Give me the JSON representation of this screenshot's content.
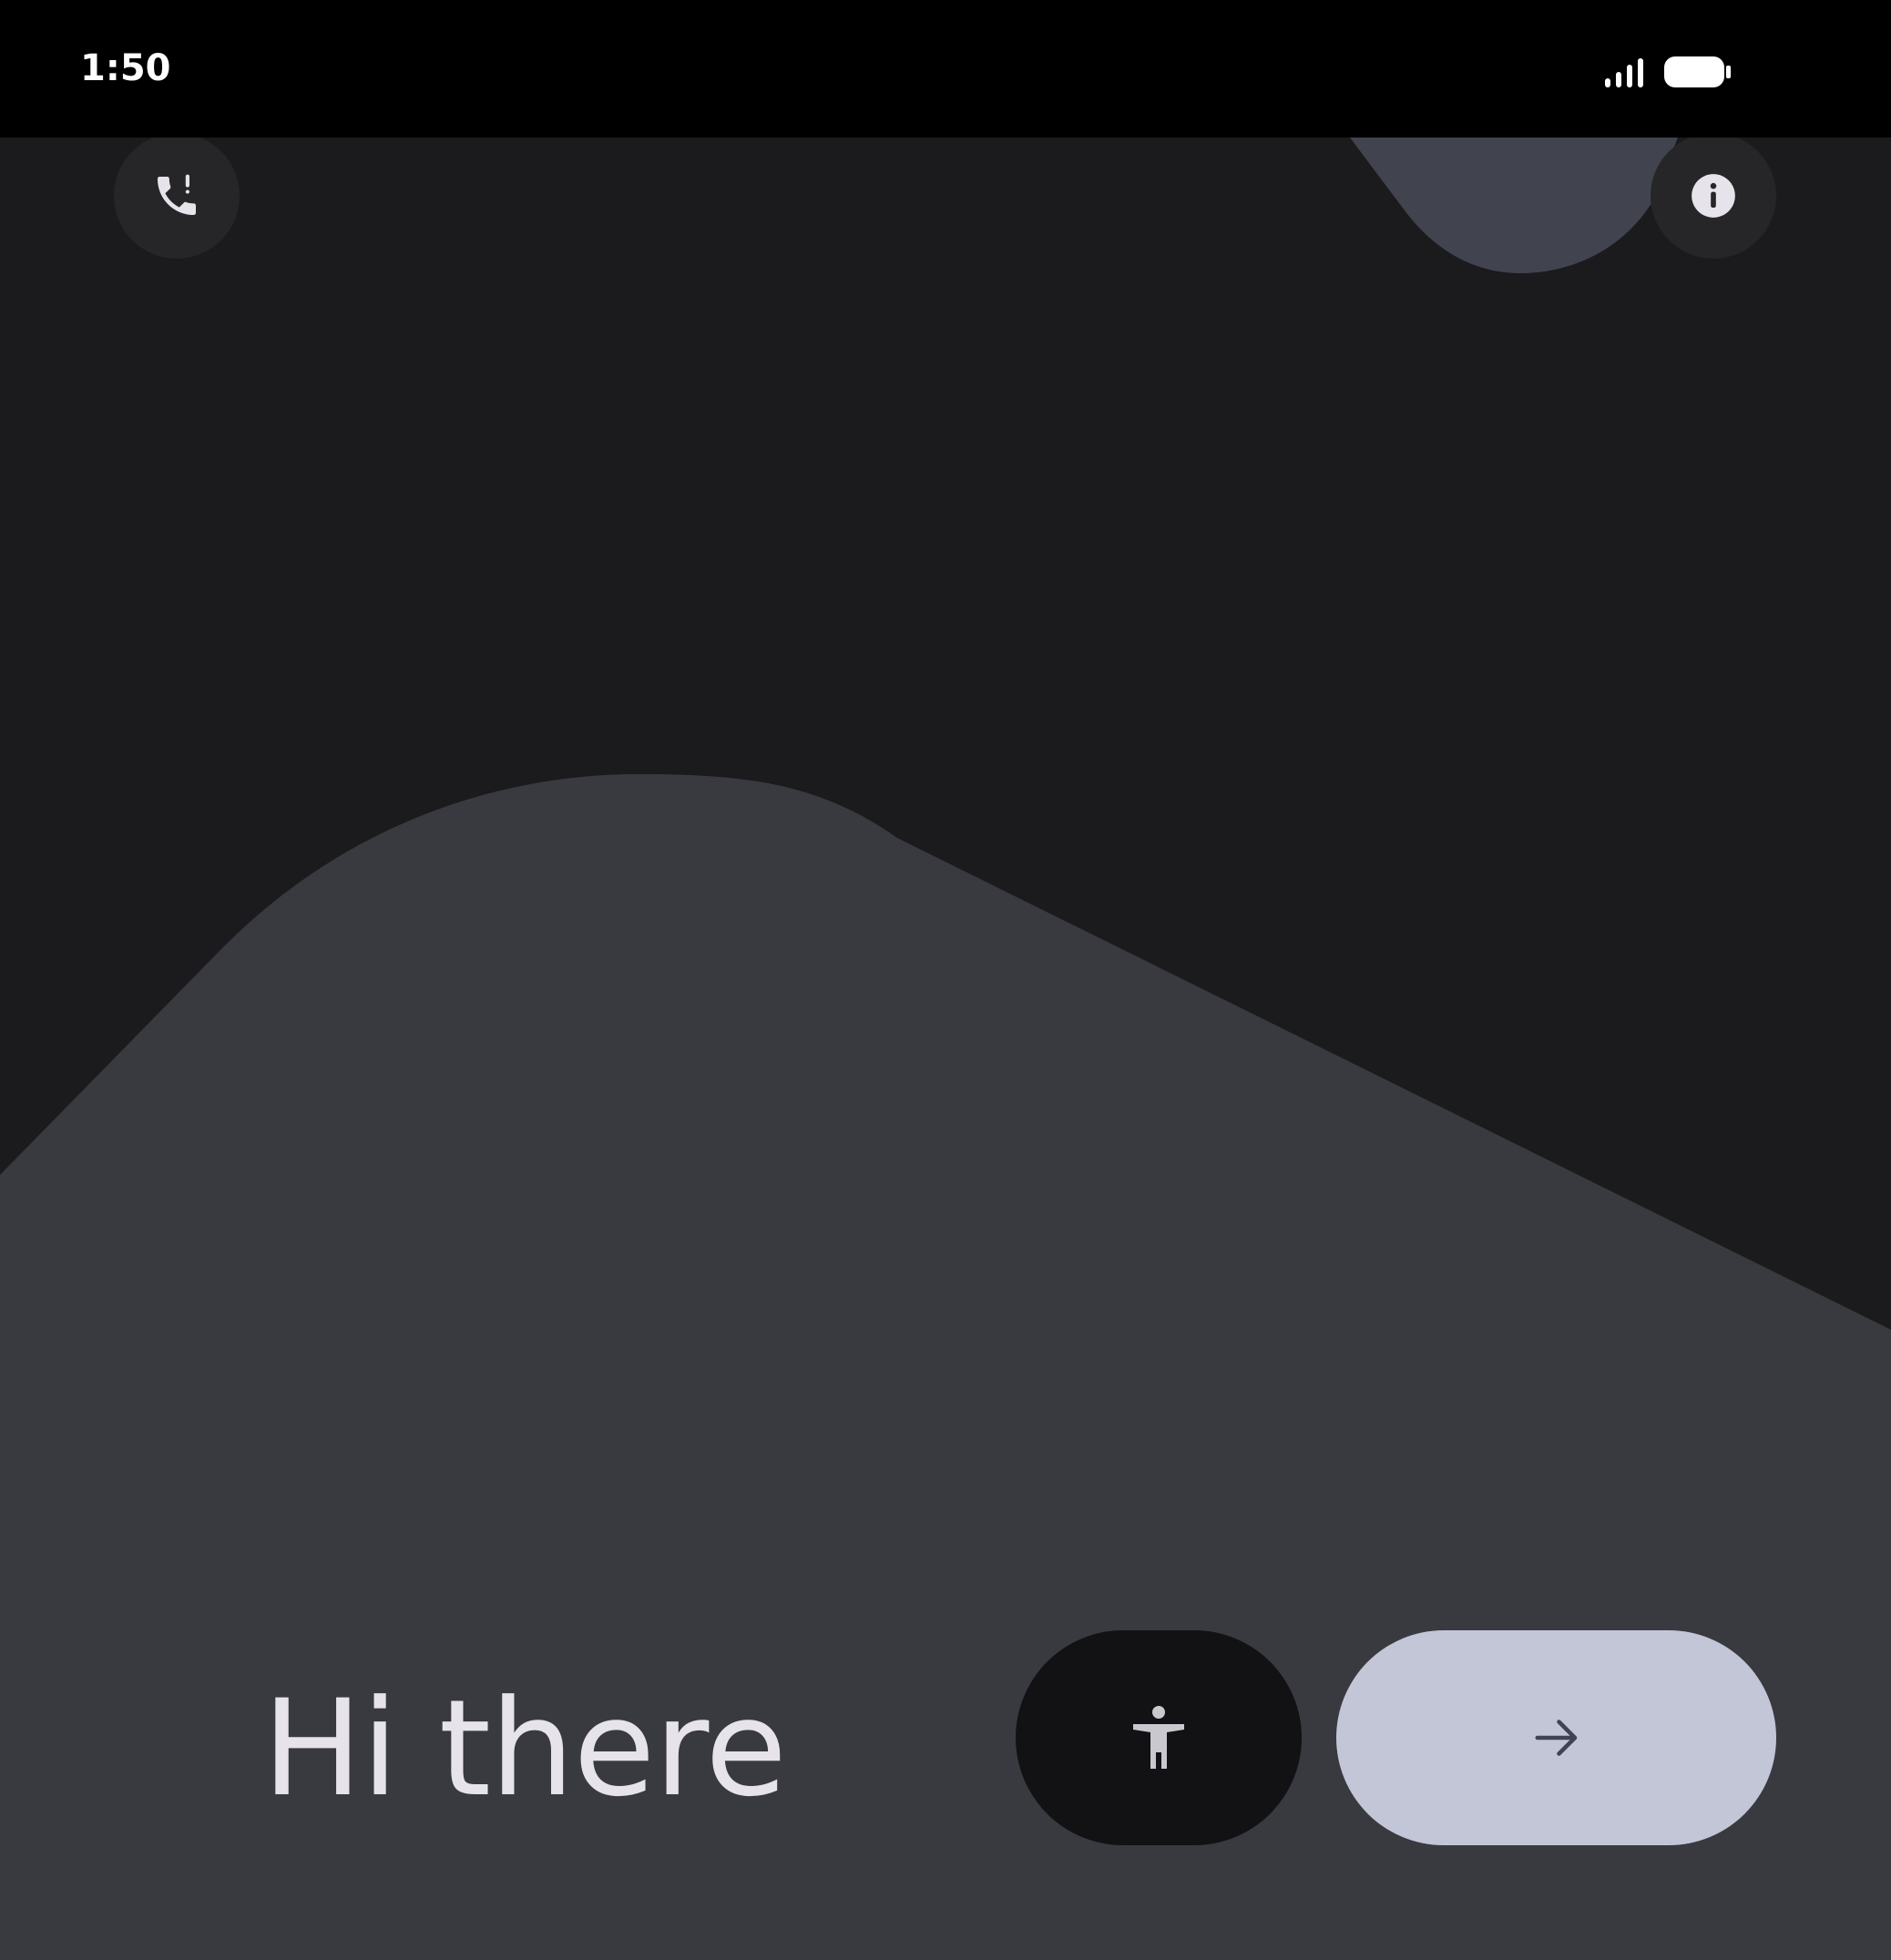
{
  "status_bar": {
    "time": "1:50",
    "signal_icon": "cellular-signal-icon",
    "battery_icon": "battery-full-icon"
  },
  "top_actions": {
    "emergency_icon": "emergency-call-icon",
    "info_icon": "info-icon"
  },
  "welcome": {
    "greeting": "Hi there"
  },
  "bottom_actions": {
    "accessibility_icon": "accessibility-icon",
    "next_icon": "arrow-forward-icon"
  },
  "colors": {
    "background": "#1b1b1d",
    "hill_shape": "#393a40",
    "top_blob": "#41444f",
    "greeting_text": "#e6e4ea",
    "accessibility_button_bg": "#121214",
    "next_button_bg": "#c3c6d7",
    "next_arrow": "#3f4355"
  }
}
